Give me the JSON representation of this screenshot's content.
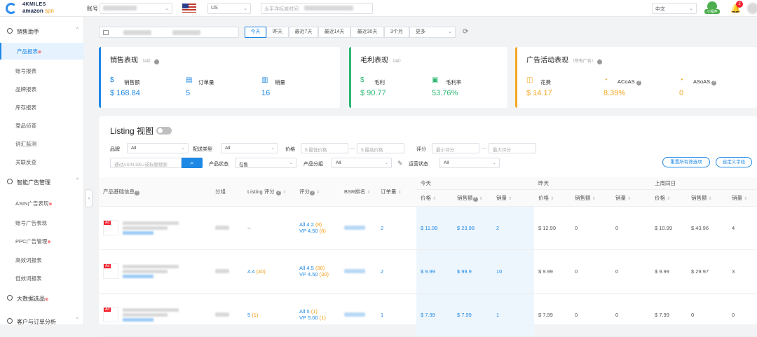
{
  "topbar": {
    "brand_line1": "4KMILES",
    "brand_line2a": "amazon",
    "brand_line2b": "spn",
    "account_label": "账号",
    "region": "US",
    "timezone": "太平洋标准时间",
    "language": "中文",
    "mini_program": "小程序",
    "notification_count": "2"
  },
  "sidebar": {
    "groups": [
      {
        "label": "销售助手"
      },
      {
        "label": "智能广告管理"
      },
      {
        "label": "大数据选品"
      },
      {
        "label": "客户与订单分析"
      }
    ],
    "items": [
      {
        "label": "产品报表"
      },
      {
        "label": "账号报表"
      },
      {
        "label": "品牌报表"
      },
      {
        "label": "库存报表"
      },
      {
        "label": "竞品侦查"
      },
      {
        "label": "词汇监测"
      },
      {
        "label": "关联反查"
      },
      {
        "label": "ASIN广告表现"
      },
      {
        "label": "账号广告表现"
      },
      {
        "label": "PPC广告管理"
      },
      {
        "label": "高效词报表"
      },
      {
        "label": "低效词报表"
      }
    ]
  },
  "quick_range": [
    "今天",
    "昨天",
    "最近7天",
    "最近14天",
    "最近30天",
    "3个月",
    "更多"
  ],
  "cards": {
    "sales": {
      "title": "销售表现",
      "scope": "（All）",
      "m1_label": "销售额",
      "m1_value": "$ 168.84",
      "m2_label": "订单量",
      "m2_value": "5",
      "m3_label": "销量",
      "m3_value": "16"
    },
    "profit": {
      "title": "毛利表现",
      "scope": "（All）",
      "m1_label": "毛利",
      "m1_value": "$ 90.77",
      "m2_label": "毛利率",
      "m2_value": "53.76%"
    },
    "ads": {
      "title": "广告活动表现",
      "scope": "（所有广告）",
      "m1_label": "花费",
      "m1_value": "$ 14.17",
      "m2_label": "ACoAS",
      "m2_value": "8.39%",
      "m3_label": "ASoAS",
      "m3_value": "0"
    }
  },
  "listing": {
    "title": "Listing 视图",
    "brand_label": "品牌",
    "brand_value": "All",
    "ship_label": "配送类型",
    "ship_value": "All",
    "price_label": "价格",
    "price_min_ph": "最低价格",
    "price_max_ph": "最高价格",
    "score_label": "评分",
    "score_min_ph": "最小评分",
    "score_max_ph": "最大评分",
    "search_ph": "通过ASIN,SKU或标题搜索",
    "status_label": "产品状态",
    "status_value": "在售",
    "group_label": "产品分组",
    "group_value": "All",
    "ops_label": "运营状态",
    "ops_value": "All",
    "reset_btn": "重置所有筛选项",
    "custom_btn": "自定义字段"
  },
  "table": {
    "col_product": "产品基础信息",
    "col_group": "分组",
    "col_listing_score": "Listing 评分",
    "col_rating": "评分",
    "col_bsr": "BSR排名",
    "col_orders": "订单量",
    "period_today": "今天",
    "period_yesterday": "昨天",
    "period_lastweek": "上周同日",
    "sub_price": "价格",
    "sub_sales": "销售额",
    "sub_units": "销量",
    "rows": [
      {
        "ad": "Ad",
        "lscore": "--",
        "lscore_n": "",
        "r_all": "All 4.2",
        "r_all_n": "(8)",
        "r_vp": "VP 4.50",
        "r_vp_n": "(8)",
        "orders": "2",
        "t_price": "$ 11.99",
        "t_sales": "$ 23.98",
        "t_units": "2",
        "y_price": "$ 12.99",
        "y_sales": "0",
        "y_units": "0",
        "w_price": "$ 10.99",
        "w_sales": "$ 43.96",
        "w_units": "4"
      },
      {
        "ad": "Ad",
        "lscore": "4.4",
        "lscore_n": "(40)",
        "r_all": "All 4.5",
        "r_all_n": "(30)",
        "r_vp": "VP 4.50",
        "r_vp_n": "(30)",
        "orders": "2",
        "t_price": "$ 9.99",
        "t_sales": "$ 99.9",
        "t_units": "10",
        "y_price": "$ 9.99",
        "y_sales": "0",
        "y_units": "0",
        "w_price": "$ 9.99",
        "w_sales": "$ 29.97",
        "w_units": "3"
      },
      {
        "ad": "Ad",
        "lscore": "5",
        "lscore_n": "(1)",
        "r_all": "All 5",
        "r_all_n": "(1)",
        "r_vp": "VP 5.00",
        "r_vp_n": "(1)",
        "orders": "1",
        "t_price": "$ 7.99",
        "t_sales": "$ 7.99",
        "t_units": "1",
        "y_price": "$ 7.99",
        "y_sales": "0",
        "y_units": "0",
        "w_price": "$ 7.99",
        "w_sales": "0",
        "w_units": "0"
      }
    ]
  }
}
